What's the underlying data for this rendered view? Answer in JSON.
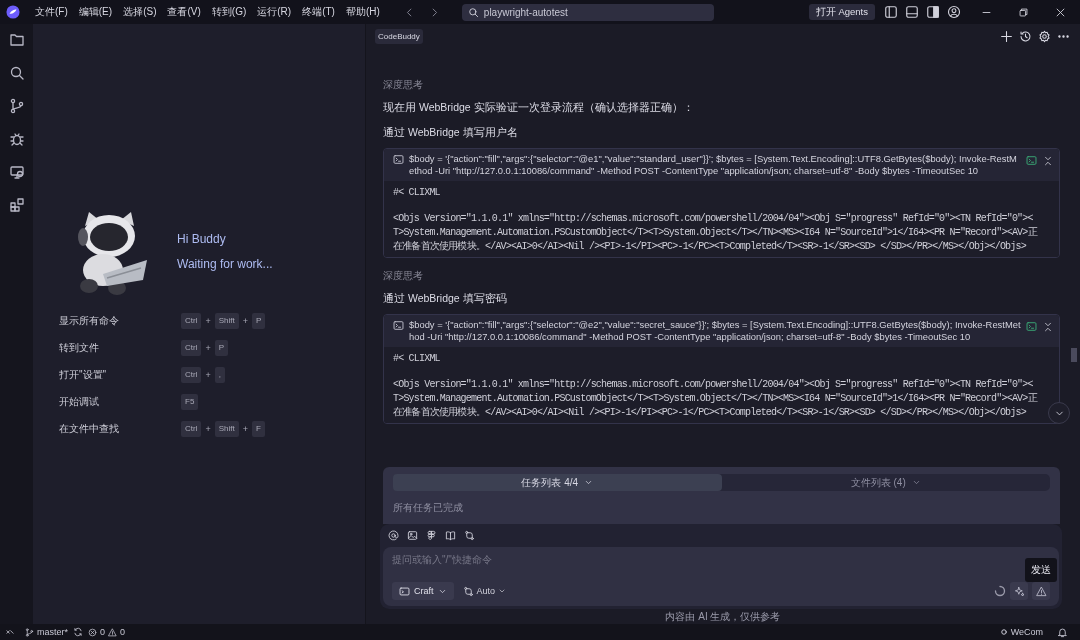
{
  "menu_bar": {
    "items": [
      "文件(F)",
      "编辑(E)",
      "选择(S)",
      "查看(V)",
      "转到(G)",
      "运行(R)",
      "终端(T)",
      "帮助(H)"
    ],
    "search": {
      "value": "playwright-autotest"
    },
    "agents_button": "打开 Agents"
  },
  "welcome": {
    "greeting": "Hi Buddy",
    "status": "Waiting for work...",
    "shortcuts": [
      {
        "label": "显示所有命令",
        "combo": [
          "Ctrl",
          "+",
          "Shift",
          "+",
          "P"
        ]
      },
      {
        "label": "转到文件",
        "combo": [
          "Ctrl",
          "+",
          "P"
        ]
      },
      {
        "label": "打开\"设置\"",
        "combo": [
          "Ctrl",
          "+",
          ","
        ]
      },
      {
        "label": "开始调试",
        "combo": [
          "F5"
        ]
      },
      {
        "label": "在文件中查找",
        "combo": [
          "Ctrl",
          "+",
          "Shift",
          "+",
          "F"
        ]
      }
    ]
  },
  "chat": {
    "tag": "CodeBuddy",
    "messages": [
      {
        "kind": "thinking",
        "text": "深度思考"
      },
      {
        "kind": "text",
        "text": "现在用 WebBridge 实际验证一次登录流程（确认选择器正确）："
      },
      {
        "kind": "heading",
        "text": "通过 WebBridge 填写用户名"
      },
      {
        "kind": "command",
        "text": "$body = '{\"action\":\"fill\",\"args\":{\"selector\":\"@e1\",\"value\":\"standard_user\"}}'; $bytes = [System.Text.Encoding]::UTF8.GetBytes($body); Invoke-RestMethod -Uri \"http://127.0.0.1:10086/command\" -Method POST -ContentType \"application/json; charset=utf-8\" -Body $bytes -TimeoutSec 10",
        "output": [
          "#< CLIXML",
          "<Objs Version=\"1.1.0.1\" xmlns=\"http://schemas.microsoft.com/powershell/2004/04\"><Obj S=\"progress\" RefId=\"0\"><TN RefId=\"0\"><",
          "T>System.Management.Automation.PSCustomObject</T><T>System.Object</T></TN><MS><I64 N=\"SourceId\">1</I64><PR N=\"Record\"><AV>正",
          "在准备首次使用模块。</AV><AI>0</AI><Nil /><PI>-1</PI><PC>-1</PC><T>Completed</T><SR>-1</SR><SD> </SD></PR></MS></Obj></Objs>"
        ]
      },
      {
        "kind": "thinking",
        "text": "深度思考"
      },
      {
        "kind": "heading",
        "text": "通过 WebBridge 填写密码"
      },
      {
        "kind": "command",
        "text": "$body = '{\"action\":\"fill\",\"args\":{\"selector\":\"@e2\",\"value\":\"secret_sauce\"}}'; $bytes = [System.Text.Encoding]::UTF8.GetBytes($body); Invoke-RestMethod -Uri \"http://127.0.0.1:10086/command\" -Method POST -ContentType \"application/json; charset=utf-8\" -Body $bytes -TimeoutSec 10",
        "output": [
          "#< CLIXML",
          "<Objs Version=\"1.1.0.1\" xmlns=\"http://schemas.microsoft.com/powershell/2004/04\"><Obj S=\"progress\" RefId=\"0\"><TN RefId=\"0\"><",
          "T>System.Management.Automation.PSCustomObject</T><T>System.Object</T></TN><MS><I64 N=\"SourceId\">1</I64><PR N=\"Record\"><AV>正",
          "在准备首次使用模块。</AV><AI>0</AI><Nil /><PI>-1</PI><PC>-1</PC><T>Completed</T><SR>-1</SR><SD> </SD></PR></MS></Obj></Objs>"
        ]
      }
    ]
  },
  "task_panel": {
    "tabs": [
      {
        "label": "任务列表 4/4",
        "selected": true
      },
      {
        "label": "文件列表 (4)",
        "selected": false
      }
    ],
    "status": "所有任务已完成"
  },
  "composer": {
    "placeholder": "提问或输入\"/\"快捷命令",
    "mode": "Craft",
    "model": "Auto",
    "tooltip": "发送"
  },
  "disclaimer": "内容由 AI 生成，仅供参考",
  "status_bar": {
    "branch": "master*",
    "errors": "0",
    "warnings": "0",
    "notifier": "WeCom"
  }
}
